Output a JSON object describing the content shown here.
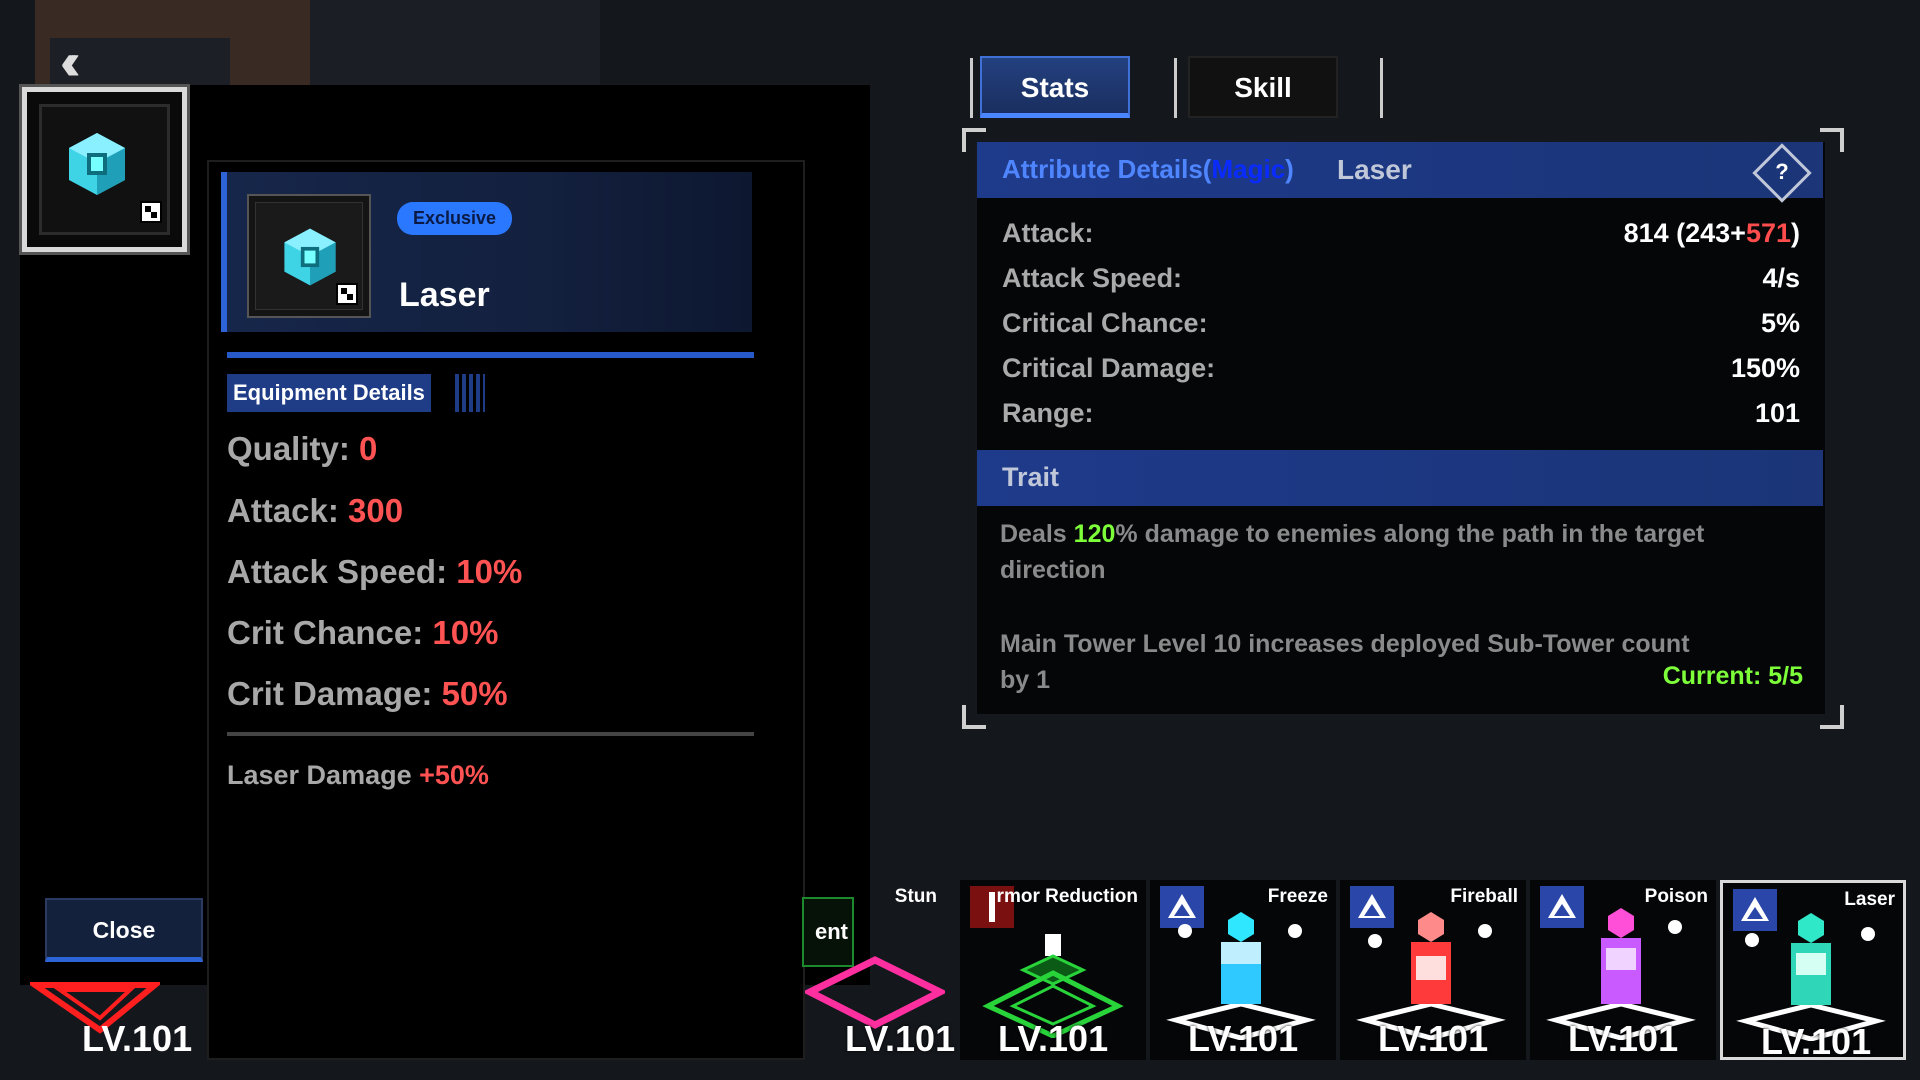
{
  "nav": {
    "back_icon": "double-chevron-left-icon"
  },
  "item": {
    "badge": "Exclusive",
    "name": "Laser",
    "section_label": "Equipment Details",
    "stats": [
      {
        "label": "Quality:",
        "value": "0"
      },
      {
        "label": "Attack:",
        "value": "300"
      },
      {
        "label": "Attack Speed:",
        "value": "10%"
      },
      {
        "label": "Crit Chance:",
        "value": "10%"
      },
      {
        "label": "Crit Damage:",
        "value": "50%"
      }
    ],
    "bonus": {
      "label": "Laser Damage",
      "value": "+50%"
    }
  },
  "close_label": "Close",
  "left_tower_level": "LV.101",
  "tabs": [
    {
      "label": "Stats",
      "active": true
    },
    {
      "label": "Skill",
      "active": false
    }
  ],
  "attributes": {
    "header_prefix": "Attribute Details(",
    "header_type": "Magic",
    "header_suffix": ")",
    "tower_name": "Laser",
    "help_icon": "question-diamond-icon",
    "rows": [
      {
        "label": "Attack:",
        "value_main": "814 (243+",
        "value_bonus": "571",
        "value_end": ")"
      },
      {
        "label": "Attack Speed:",
        "value_main": "4/s",
        "value_bonus": "",
        "value_end": ""
      },
      {
        "label": "Critical Chance:",
        "value_main": "5%",
        "value_bonus": "",
        "value_end": ""
      },
      {
        "label": "Critical Damage:",
        "value_main": "150%",
        "value_bonus": "",
        "value_end": ""
      },
      {
        "label": "Range:",
        "value_main": "101",
        "value_bonus": "",
        "value_end": ""
      }
    ],
    "trait_label": "Trait",
    "trait_line1_pre": "Deals ",
    "trait_line1_pct": "120",
    "trait_line1_post": "% damage to enemies along the path in the target",
    "trait_line2": "direction",
    "trait_sub1": "Main Tower Level 10 increases deployed Sub-Tower count",
    "trait_sub2": "by 1",
    "current": "Current: 5/5"
  },
  "partial_button_text": "ent",
  "towers": [
    {
      "name": "Stun",
      "level": "LV.101",
      "icon": "none",
      "color": "#ff2fa0"
    },
    {
      "name": "rmor Reduction",
      "level": "LV.101",
      "icon": "sword-icon",
      "color": "#28d43a"
    },
    {
      "name": "Freeze",
      "level": "LV.101",
      "icon": "triangle-icon",
      "color": "#2fc8ff"
    },
    {
      "name": "Fireball",
      "level": "LV.101",
      "icon": "triangle-icon",
      "color": "#ff3a3a"
    },
    {
      "name": "Poison",
      "level": "LV.101",
      "icon": "triangle-icon",
      "color": "#c85aff"
    },
    {
      "name": "Laser",
      "level": "LV.101",
      "icon": "triangle-icon",
      "color": "#2fd6b8",
      "selected": true
    }
  ]
}
